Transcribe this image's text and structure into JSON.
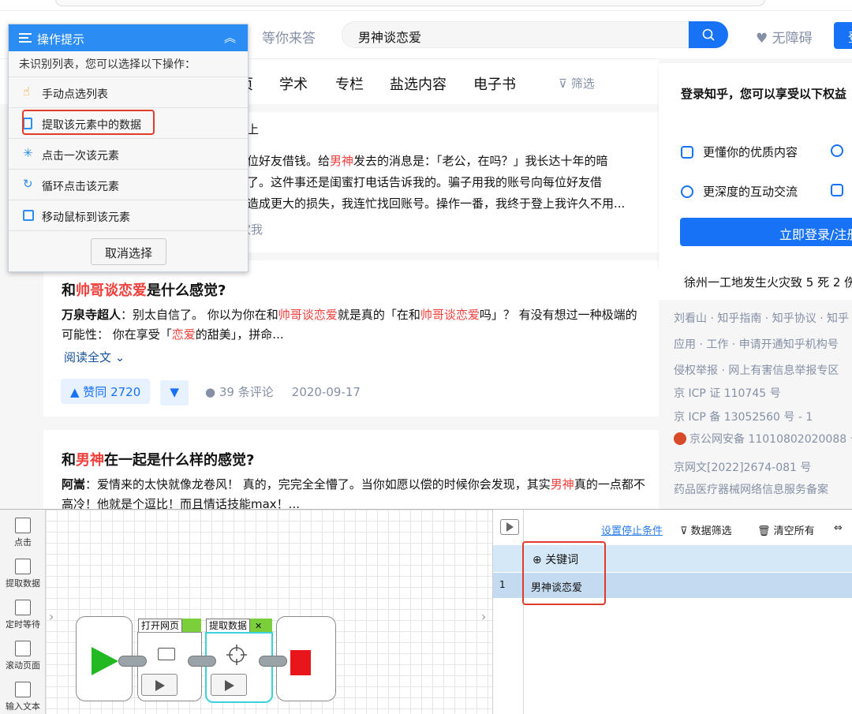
{
  "header": {
    "nav_waiting": "等你来答",
    "search_value": "男神谈恋爱",
    "accessibility": "无障碍",
    "login_short": "登"
  },
  "tabs": {
    "items": [
      "学术",
      "专栏",
      "盐选内容",
      "电子书"
    ],
    "partial_left": "页",
    "filter": "筛选"
  },
  "card1": {
    "line1_pre": "位好友借钱。给",
    "line1_hl": "男神",
    "line1_post": "发去的消息是：「老公，在吗？」我长达十年的暗",
    "line2": "了。这件事还是闺蜜打电话告诉我的。骗子用我的账号向每位好友借",
    "line3": "造成更大的损失，我连忙找回账号。操作一番，我终于登上我许久不用...",
    "line4": "欢我",
    "line0": "上"
  },
  "card2": {
    "title_pre": "和",
    "title_hl": "帅哥谈恋爱",
    "title_post": "是什么感觉?",
    "author": "万泉寺超人",
    "ex_a": "：别太自信了。 你以为你在和",
    "ex_b": "帅哥谈恋爱",
    "ex_c": "就是真的「在和",
    "ex_d": "帅哥谈恋爱",
    "ex_e": "吗」？ 有没有想过一种极",
    "ex_f": "端的可能性： 你在享受「",
    "ex_g": "恋爱",
    "ex_h": "的甜美」，拼命...",
    "readmore": "阅读全文",
    "upvote": "▲ 赞同 2720",
    "downvote": "▼",
    "comments": "39 条评论",
    "date": "2020-09-17"
  },
  "card3": {
    "title_pre": "和",
    "title_hl": "男神",
    "title_post": "在一起是什么样的感觉?",
    "author": "阿嵩",
    "ex_a": "：爱情来的太快就像龙卷风！ 真的，完完全全懵了。当你如愿以偿的时候你会发现，其实",
    "ex_b": "男神",
    "ex_c": "真的一",
    "ex_d": "点都不高冷！他就是个逗比！而且情话技能max！..."
  },
  "rightcard": {
    "title": "登录知乎，您可以享受以下权益",
    "row1": "更懂你的优质内容",
    "row2": "更深度的互动交流",
    "cta": "立即登录/注册"
  },
  "news": "徐州一工地发生火灾致 5 死 2 伤",
  "footer": [
    "刘看山 · 知乎指南 · 知乎协议 · 知乎",
    "应用 · 工作 · 申请开通知乎机构号",
    "侵权举报 · 网上有害信息举报专区",
    "京 ICP 证 110745 号",
    "京 ICP 备 13052560 号 - 1",
    "京公网安备 11010802020088 号",
    "京网文[2022]2674-081 号",
    "药品医疗器械网络信息服务备案"
  ],
  "popup": {
    "title": "操作提示",
    "chevron": "︽",
    "subtitle": "未识别列表，您可以选择以下操作：",
    "items": [
      "手动点选列表",
      "提取该元素中的数据",
      "点击一次该元素",
      "循环点击该元素",
      "移动鼠标到该元素"
    ],
    "cancel": "取消选择"
  },
  "tools": [
    "点击",
    "提取数据",
    "定时等待",
    "滚动页面",
    "输入文本"
  ],
  "flow": {
    "open_page": "打开网页",
    "extract": "提取数据",
    "close_x": "✕"
  },
  "datapanel": {
    "stop_condition": "设置停止条件",
    "filter": "数据筛选",
    "clear": "清空所有",
    "column": "关键词",
    "row_index": "1",
    "row_value": "男神谈恋爱"
  },
  "colors": {
    "brand": "#1772f6",
    "highlight": "#f1403c",
    "popup_head": "#2b8df3",
    "red_box": "#e03b2b"
  }
}
